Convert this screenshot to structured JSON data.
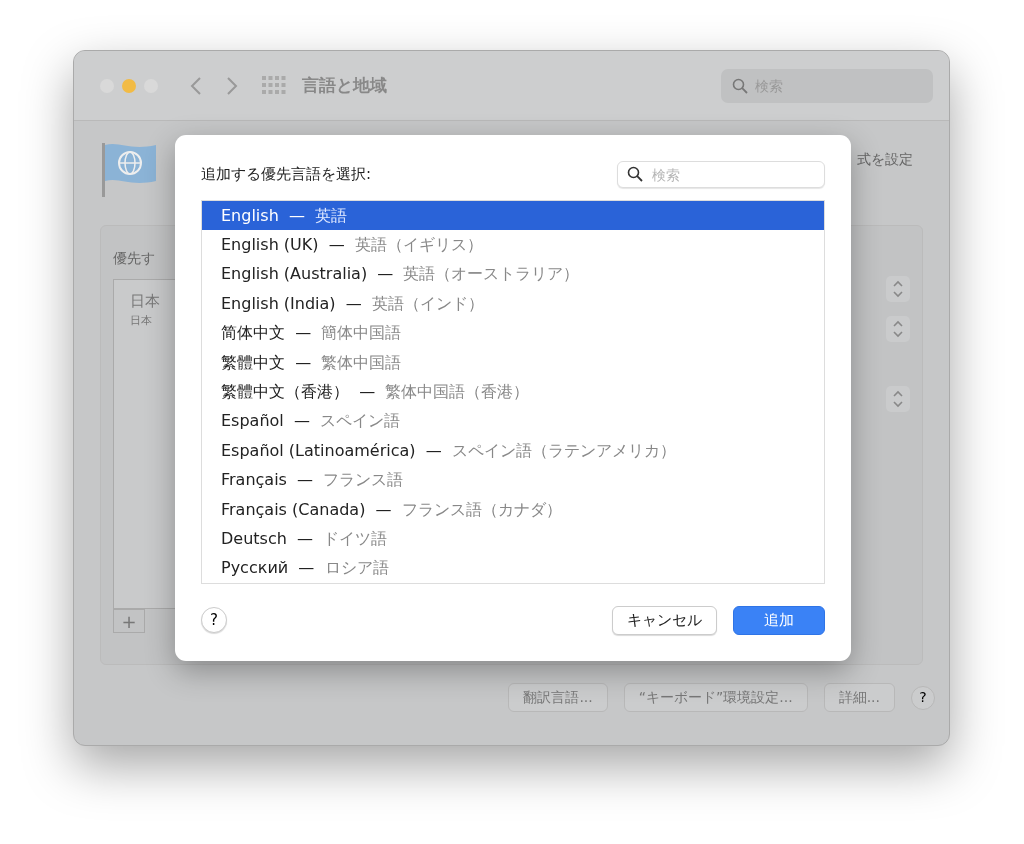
{
  "window": {
    "title": "言語と地域",
    "search": {
      "placeholder": "検索"
    }
  },
  "background": {
    "header_text": "式を設定",
    "list_label": "優先す",
    "list_items": [
      {
        "name": "日本",
        "detail": "日本"
      }
    ],
    "add_button": "+",
    "buttons": [
      "翻訳言語...",
      "“キーボード”環境設定...",
      "詳細..."
    ],
    "help": "?"
  },
  "sheet": {
    "prompt": "追加する優先言語を選択:",
    "search": {
      "placeholder": "検索"
    },
    "languages": [
      {
        "name": "English",
        "native": "英語",
        "selected": true
      },
      {
        "name": "English (UK)",
        "native": "英語（イギリス）",
        "selected": false
      },
      {
        "name": "English (Australia)",
        "native": "英語（オーストラリア）",
        "selected": false
      },
      {
        "name": "English (India)",
        "native": "英語（インド）",
        "selected": false
      },
      {
        "name": "简体中文",
        "native": "簡体中国語",
        "selected": false
      },
      {
        "name": "繁體中文",
        "native": "繁体中国語",
        "selected": false
      },
      {
        "name": "繁體中文（香港）",
        "native": "繁体中国語（香港）",
        "selected": false
      },
      {
        "name": "Español",
        "native": "スペイン語",
        "selected": false
      },
      {
        "name": "Español (Latinoamérica)",
        "native": "スペイン語（ラテンアメリカ）",
        "selected": false
      },
      {
        "name": "Français",
        "native": "フランス語",
        "selected": false
      },
      {
        "name": "Français (Canada)",
        "native": "フランス語（カナダ）",
        "selected": false
      },
      {
        "name": "Deutsch",
        "native": "ドイツ語",
        "selected": false
      },
      {
        "name": "Русский",
        "native": "ロシア語",
        "selected": false
      }
    ],
    "separator": "—",
    "help": "?",
    "buttons": [
      {
        "label": "キャンセル",
        "kind": "cancel"
      },
      {
        "label": "追加",
        "kind": "default"
      }
    ]
  }
}
